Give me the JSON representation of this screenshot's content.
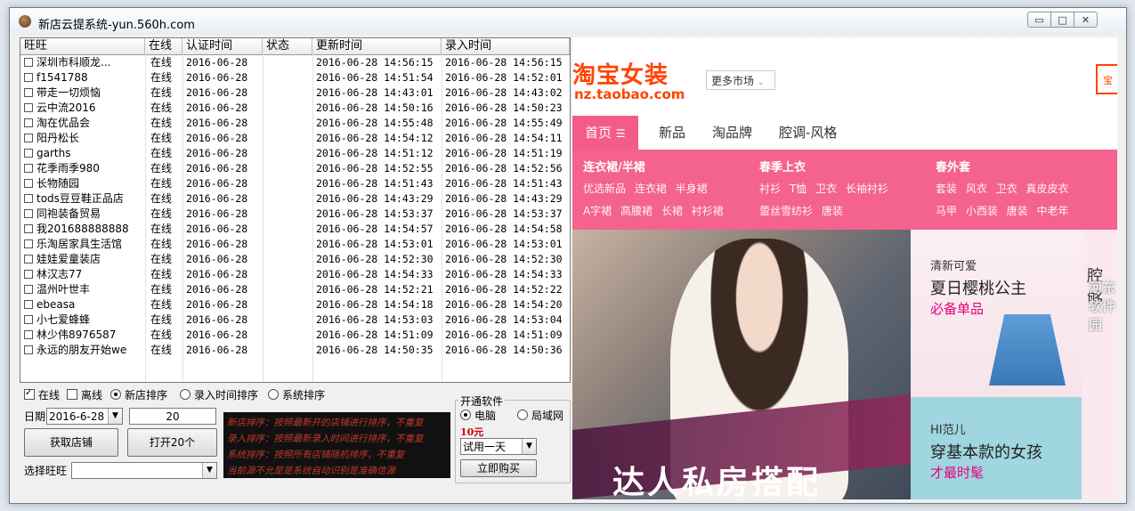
{
  "window": {
    "title": "新店云提系统-yun.560h.com",
    "controls": [
      "▭",
      "□",
      "✕"
    ]
  },
  "listview": {
    "columns": [
      "旺旺",
      "在线",
      "认证时间",
      "状态",
      "更新时间",
      "录入时间"
    ],
    "rows": [
      {
        "name": "深圳市科顺龙...",
        "online": "在线",
        "auth": "2016-06-28",
        "status": "",
        "updated": "2016-06-28 14:56:15",
        "entered": "2016-06-28 14:56:15"
      },
      {
        "name": "f1541788",
        "online": "在线",
        "auth": "2016-06-28",
        "status": "",
        "updated": "2016-06-28 14:51:54",
        "entered": "2016-06-28 14:52:01"
      },
      {
        "name": "带走一切烦恼",
        "online": "在线",
        "auth": "2016-06-28",
        "status": "",
        "updated": "2016-06-28 14:43:01",
        "entered": "2016-06-28 14:43:02"
      },
      {
        "name": "云中流2016",
        "online": "在线",
        "auth": "2016-06-28",
        "status": "",
        "updated": "2016-06-28 14:50:16",
        "entered": "2016-06-28 14:50:23"
      },
      {
        "name": "淘在优品会",
        "online": "在线",
        "auth": "2016-06-28",
        "status": "",
        "updated": "2016-06-28 14:55:48",
        "entered": "2016-06-28 14:55:49"
      },
      {
        "name": "阳丹松长",
        "online": "在线",
        "auth": "2016-06-28",
        "status": "",
        "updated": "2016-06-28 14:54:12",
        "entered": "2016-06-28 14:54:11"
      },
      {
        "name": "garths",
        "online": "在线",
        "auth": "2016-06-28",
        "status": "",
        "updated": "2016-06-28 14:51:12",
        "entered": "2016-06-28 14:51:19"
      },
      {
        "name": "花季雨季980",
        "online": "在线",
        "auth": "2016-06-28",
        "status": "",
        "updated": "2016-06-28 14:52:55",
        "entered": "2016-06-28 14:52:56"
      },
      {
        "name": "长物随园",
        "online": "在线",
        "auth": "2016-06-28",
        "status": "",
        "updated": "2016-06-28 14:51:43",
        "entered": "2016-06-28 14:51:43"
      },
      {
        "name": "tods豆豆鞋正品店",
        "online": "在线",
        "auth": "2016-06-28",
        "status": "",
        "updated": "2016-06-28 14:43:29",
        "entered": "2016-06-28 14:43:29"
      },
      {
        "name": "同袍装备贸易",
        "online": "在线",
        "auth": "2016-06-28",
        "status": "",
        "updated": "2016-06-28 14:53:37",
        "entered": "2016-06-28 14:53:37"
      },
      {
        "name": "我201688888888",
        "online": "在线",
        "auth": "2016-06-28",
        "status": "",
        "updated": "2016-06-28 14:54:57",
        "entered": "2016-06-28 14:54:58"
      },
      {
        "name": "乐淘居家具生活馆",
        "online": "在线",
        "auth": "2016-06-28",
        "status": "",
        "updated": "2016-06-28 14:53:01",
        "entered": "2016-06-28 14:53:01"
      },
      {
        "name": "娃娃爱童装店",
        "online": "在线",
        "auth": "2016-06-28",
        "status": "",
        "updated": "2016-06-28 14:52:30",
        "entered": "2016-06-28 14:52:30"
      },
      {
        "name": "林汉志77",
        "online": "在线",
        "auth": "2016-06-28",
        "status": "",
        "updated": "2016-06-28 14:54:33",
        "entered": "2016-06-28 14:54:33"
      },
      {
        "name": "温州叶世丰",
        "online": "在线",
        "auth": "2016-06-28",
        "status": "",
        "updated": "2016-06-28 14:52:21",
        "entered": "2016-06-28 14:52:22"
      },
      {
        "name": "ebeasa",
        "online": "在线",
        "auth": "2016-06-28",
        "status": "",
        "updated": "2016-06-28 14:54:18",
        "entered": "2016-06-28 14:54:20"
      },
      {
        "name": "小七爱蜂蜂",
        "online": "在线",
        "auth": "2016-06-28",
        "status": "",
        "updated": "2016-06-28 14:53:03",
        "entered": "2016-06-28 14:53:04"
      },
      {
        "name": "林少伟8976587",
        "online": "在线",
        "auth": "2016-06-28",
        "status": "",
        "updated": "2016-06-28 14:51:09",
        "entered": "2016-06-28 14:51:09"
      },
      {
        "name": "永远的朋友开始we",
        "online": "在线",
        "auth": "2016-06-28",
        "status": "",
        "updated": "2016-06-28 14:50:35",
        "entered": "2016-06-28 14:50:36"
      }
    ]
  },
  "filters": {
    "online": "在线",
    "offline": "离线",
    "sort_new": "新店排序",
    "sort_entry": "录入时间排序",
    "sort_system": "系统排序"
  },
  "controls": {
    "date_label": "日期",
    "date_value": "2016-6-28",
    "count_value": "20",
    "fetch_button": "获取店铺",
    "open_button": "打开20个",
    "select_label": "选择旺旺",
    "select_value": ""
  },
  "notice": {
    "lines": [
      "新店排序：按照最新开的店铺进行排序，不重复",
      "录入排序：按照最新录入时间进行排序，不重复",
      "系统排序：按照所有店铺随机排序，不重复",
      "当前源不允是是系统自动识别是准确信源"
    ]
  },
  "purchase": {
    "group_title": "开通软件",
    "pc": "电脑",
    "lan": "局域网",
    "price": "10元",
    "plan_value": "试用一天",
    "buy_button": "立即购买"
  },
  "browser": {
    "logo": "淘宝女装",
    "url": "nz.taobao.com",
    "more_market": "更多市场",
    "search_stub": "宝",
    "nav": [
      "首页",
      "新品",
      "淘品牌",
      "腔调-风格"
    ],
    "categories": [
      {
        "title": "连衣裙/半裙",
        "row1": "优选新品 连衣裙 半身裙",
        "row2": "A字裙 高腰裙 长裙 衬衫裙"
      },
      {
        "title": "春季上衣",
        "row1": "衬衫 T恤 卫衣 长袖衬衫",
        "row2": "蕾丝雪纺衫 唐装"
      },
      {
        "title": "春外套",
        "row1": "套装 风衣 卫衣 真皮皮衣",
        "row2": "马甲 小西装 唐装 中老年"
      }
    ],
    "hero_text": "达人私房搭配",
    "promo1": {
      "tag": "清新可爱",
      "head": "夏日樱桃公主",
      "sub": "必备单品"
    },
    "promo2": {
      "tag": "HI范儿",
      "head": "穿基本款的女孩",
      "sub": "才最时髦"
    },
    "edge_text": "腔够",
    "watermark": "河东软件园"
  }
}
